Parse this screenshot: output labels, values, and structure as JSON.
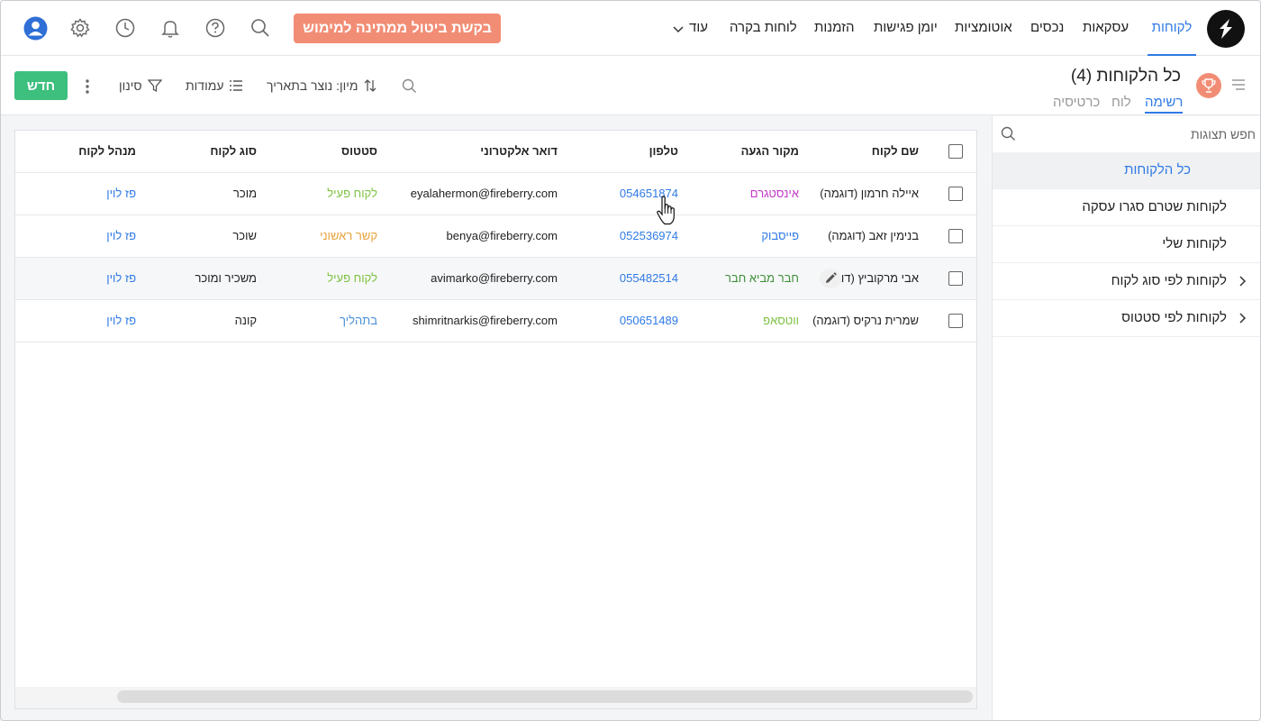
{
  "nav": {
    "items": [
      {
        "label": "לקוחות",
        "active": true
      },
      {
        "label": "עסקאות",
        "active": false
      },
      {
        "label": "נכסים",
        "active": false
      },
      {
        "label": "אוטומציות",
        "active": false
      },
      {
        "label": "יומן פגישות",
        "active": false
      },
      {
        "label": "הזמנות",
        "active": false
      },
      {
        "label": "לוחות בקרה",
        "active": false
      },
      {
        "label": "עוד",
        "active": false
      }
    ],
    "cta_label": "בקשת ביטול ממתינה למימוש"
  },
  "page": {
    "title": "כל הלקוחות",
    "count": "(4)",
    "view_tabs": [
      "רשימה",
      "לוח",
      "כרטיסיה"
    ]
  },
  "toolbar": {
    "sort_label": "מיון: נוצר בתאריך",
    "columns_label": "עמודות",
    "filter_label": "סינון",
    "new_label": "חדש"
  },
  "sidebar": {
    "search_placeholder": "חפש תצוגות",
    "items": [
      {
        "label": "כל הלקוחות",
        "active": true
      },
      {
        "label": "לקוחות שטרם סגרו עסקה"
      },
      {
        "label": "לקוחות שלי"
      },
      {
        "label": "לקוחות לפי סוג לקוח",
        "expandable": true
      },
      {
        "label": "לקוחות לפי סטטוס",
        "expandable": true
      }
    ]
  },
  "table": {
    "headers": {
      "name": "שם לקוח",
      "source": "מקור הגעה",
      "phone": "טלפון",
      "email": "דואר אלקטרוני",
      "status": "סטטוס",
      "type": "סוג לקוח",
      "manager": "מנהל לקוח"
    },
    "rows": [
      {
        "name": "איילה חרמון (דוגמה)",
        "source": "אינסטגרם",
        "source_color": "#c23ac7",
        "phone": "054651874",
        "email": "eyalahermon@fireberry.com",
        "status": "לקוח פעיל",
        "status_color": "#7ec242",
        "type": "מוכר",
        "manager": "פז לוין"
      },
      {
        "name": "בנימין זאב (דוגמה)",
        "source": "פייסבוק",
        "source_color": "#2f7ae5",
        "phone": "052536974",
        "email": "benya@fireberry.com",
        "status": "קשר ראשוני",
        "status_color": "#e8a23a",
        "type": "שוכר",
        "manager": "פז לוין"
      },
      {
        "name": "אבי מרקוביץ (דוג",
        "source": "חבר מביא חבר",
        "source_color": "#3f8f3a",
        "phone": "055482514",
        "email": "avimarko@fireberry.com",
        "status": "לקוח פעיל",
        "status_color": "#7ec242",
        "type": "משכיר ומוכר",
        "manager": "פז לוין"
      },
      {
        "name": "שמרית נרקיס (דוגמה)",
        "source": "ווטסאפ",
        "source_color": "#7ec242",
        "phone": "050651489",
        "email": "shimritnarkis@fireberry.com",
        "status": "בתהליך",
        "status_color": "#4a90d9",
        "type": "קונה",
        "manager": "פז לוין"
      }
    ]
  },
  "colors": {
    "accent": "#2f7ae5",
    "cta": "#f28d75",
    "new_button": "#3dbf7e"
  }
}
